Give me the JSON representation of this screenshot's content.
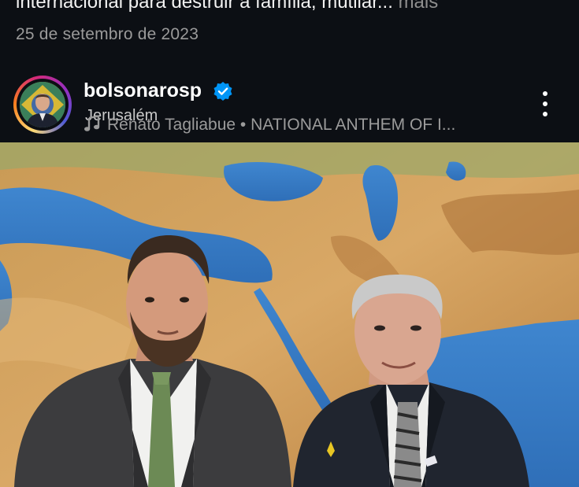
{
  "post": {
    "caption_visible": "internacional para destruir a família, mutilar...",
    "more_label": "mais",
    "date": "25 de setembro de 2023"
  },
  "account": {
    "username": "bolsonarosp",
    "verified": true,
    "location": "Jerusalém"
  },
  "audio": {
    "line": "Renato Tagliabue • NATIONAL ANTHEM OF I..."
  },
  "icons": {
    "verified": "verified-badge-icon",
    "music": "music-note-icon",
    "options": "more-options-icon"
  },
  "colors": {
    "background": "#0c0f14",
    "verified_blue": "#0095f6",
    "secondary_text": "#9a9a9a"
  }
}
